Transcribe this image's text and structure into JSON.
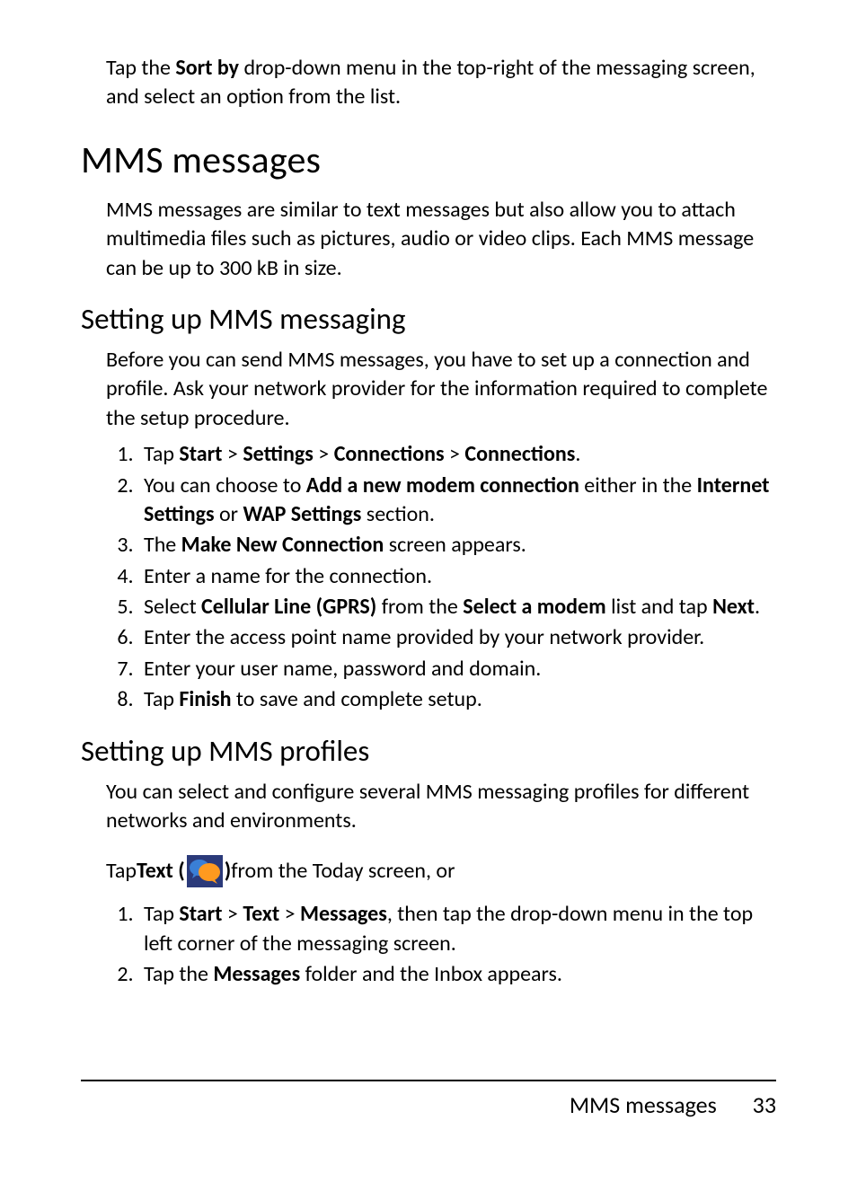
{
  "intro": {
    "pre": "Tap the ",
    "bold": "Sort by",
    "post": " drop-down menu in the top-right of the messaging screen, and select an option from the list."
  },
  "h1": "MMS messages",
  "mms_desc": "MMS messages are similar to text messages but also allow you to attach multimedia files such as pictures, audio or video clips. Each MMS message can be up to 300 kB in size.",
  "h2a": "Setting up MMS messaging",
  "setup_desc": "Before you can send MMS messages, you have to set up a connection and profile. Ask your network provider for the information required to complete the setup procedure.",
  "steps_a": {
    "s1": {
      "pre": "Tap ",
      "b1": "Start",
      "sep1": " > ",
      "b2": "Settings",
      "sep2": " > ",
      "b3": "Connections",
      "sep3": " > ",
      "b4": "Connections",
      "post": "."
    },
    "s2": {
      "pre": "You can choose to ",
      "b1": "Add a new modem connection",
      "mid": " either in the ",
      "b2": "Internet Settings",
      "mid2": " or ",
      "b3": "WAP Settings",
      "post": " section."
    },
    "s3": {
      "pre": "The ",
      "b1": "Make New Connection",
      "post": " screen appears."
    },
    "s4": "Enter a name for the connection.",
    "s5": {
      "pre": "Select ",
      "b1": "Cellular Line (GPRS)",
      "mid": " from the ",
      "b2": "Select a modem",
      "mid2": " list and tap ",
      "b3": "Next",
      "post": "."
    },
    "s6": "Enter the access point name provided by your network provider.",
    "s7": "Enter your user name, password and domain.",
    "s8": {
      "pre": "Tap ",
      "b1": "Finish",
      "post": " to save and complete setup."
    }
  },
  "h2b": "Setting up MMS profiles",
  "profiles_desc": "You can select and configure several MMS messaging profiles for different networks and environments.",
  "tap_text": {
    "pre": "Tap ",
    "b1": "Text (",
    "b2": ")",
    "post": " from the Today screen, or"
  },
  "steps_b": {
    "s1": {
      "pre": "Tap ",
      "b1": "Start",
      "sep1": " > ",
      "b2": "Text",
      "sep2": " > ",
      "b3": "Messages",
      "post": ", then tap the drop-down menu in the top left corner of the messaging screen."
    },
    "s2": {
      "pre": "Tap the ",
      "b1": "Messages",
      "post": " folder and the Inbox appears."
    }
  },
  "footer": {
    "title": "MMS messages",
    "page": "33"
  }
}
